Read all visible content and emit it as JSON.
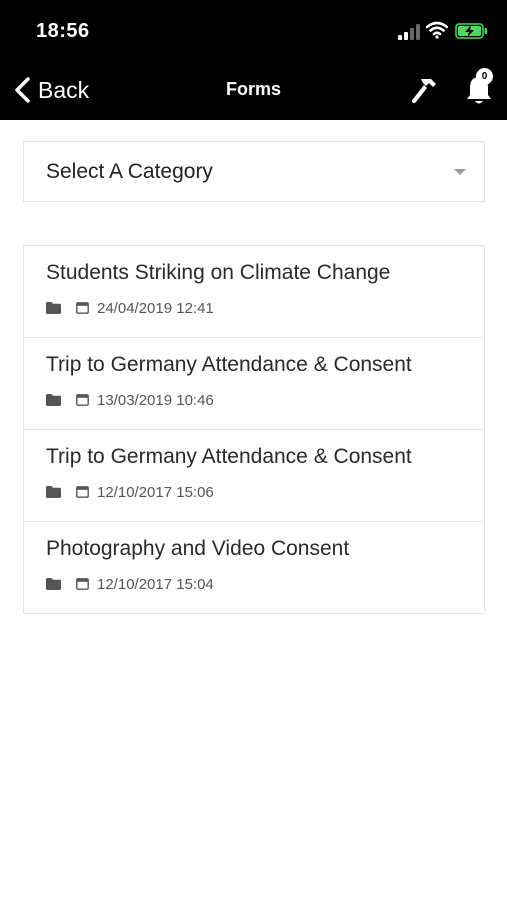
{
  "status_bar": {
    "time": "18:56",
    "signal_icon": "cellular-signal-icon",
    "wifi_icon": "wifi-icon",
    "battery_icon": "battery-charging-icon",
    "battery_color": "#4cd964"
  },
  "nav": {
    "back_label": "Back",
    "title": "Forms",
    "tools_icon": "hammer-icon",
    "notifications_icon": "bell-icon",
    "notification_count": "0"
  },
  "category_select": {
    "label": "Select A Category",
    "caret_icon": "caret-down-icon"
  },
  "forms": [
    {
      "title": "Students Striking on Climate Change",
      "date": "24/04/2019 12:41"
    },
    {
      "title": "Trip to Germany Attendance & Consent",
      "date": "13/03/2019 10:46"
    },
    {
      "title": "Trip to Germany Attendance & Consent",
      "date": "12/10/2017 15:06"
    },
    {
      "title": "Photography and Video Consent",
      "date": "12/10/2017 15:04"
    }
  ],
  "colors": {
    "header_background": "#000000",
    "header_text": "#ffffff",
    "border": "#e6e6e6",
    "text": "#2a2a2a"
  }
}
